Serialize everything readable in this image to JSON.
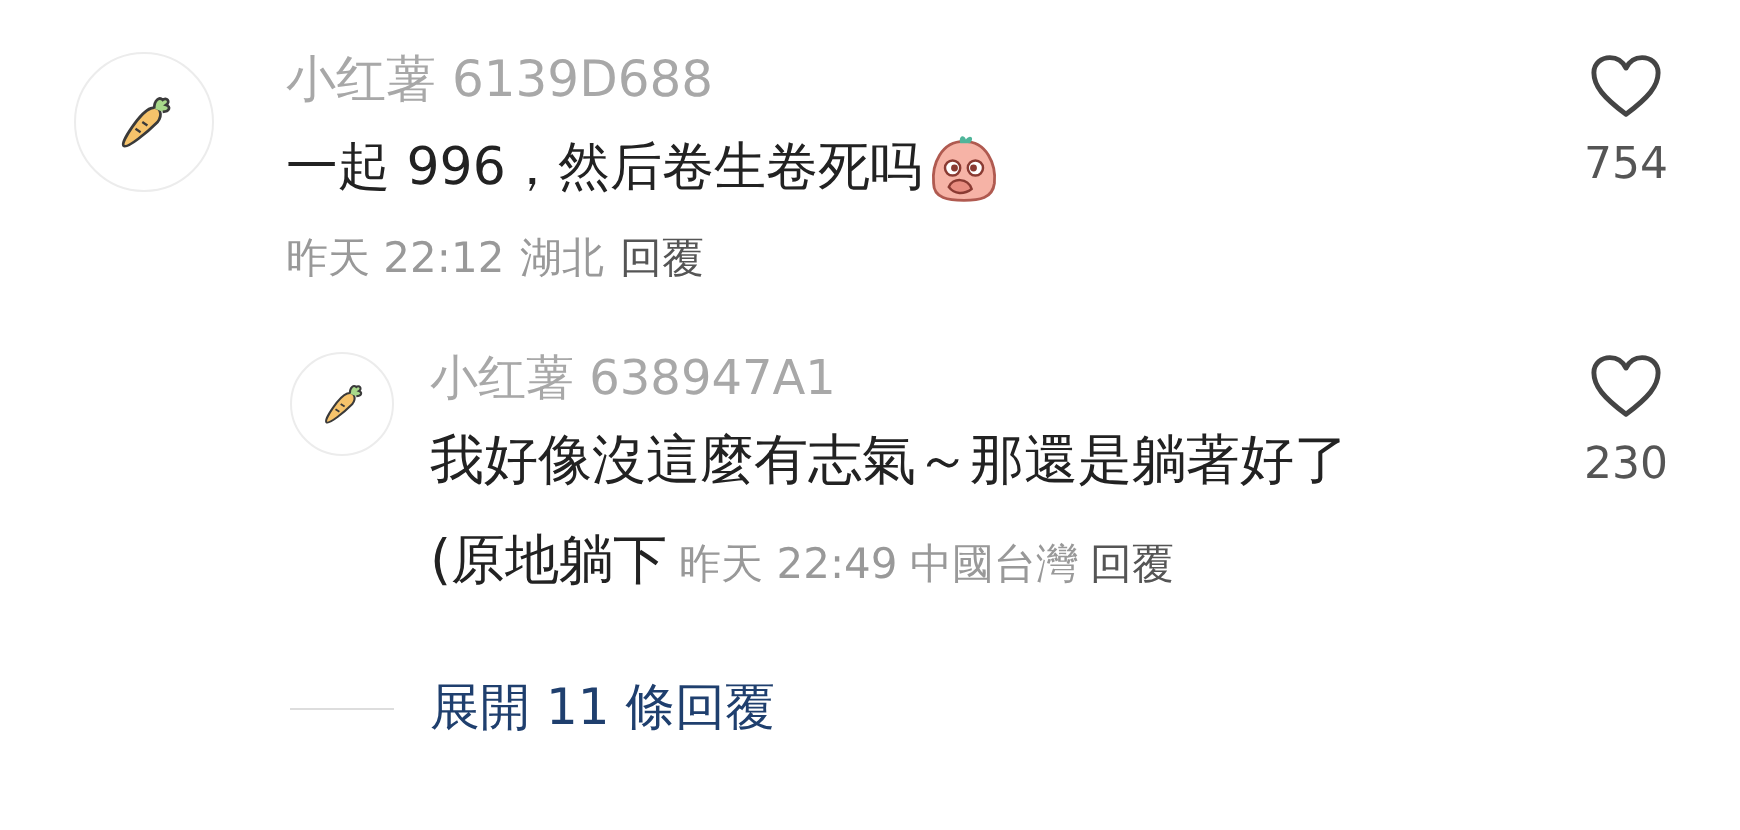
{
  "comments": [
    {
      "author": "小红薯 6139D688",
      "text": "一起 996，然后卷生卷死吗",
      "sticker": true,
      "date": "昨天 22:12",
      "location": "湖北",
      "reply_action": "回覆",
      "likes": "754",
      "replies": [
        {
          "author": "小红薯 638947A1",
          "text_lines": [
            "我好像沒這麼有志氣～那還是躺著好了",
            "(原地躺下"
          ],
          "date": "昨天 22:49",
          "location": "中國台灣",
          "reply_action": "回覆",
          "likes": "230"
        }
      ],
      "expand_replies": "展開 11 條回覆"
    }
  ]
}
